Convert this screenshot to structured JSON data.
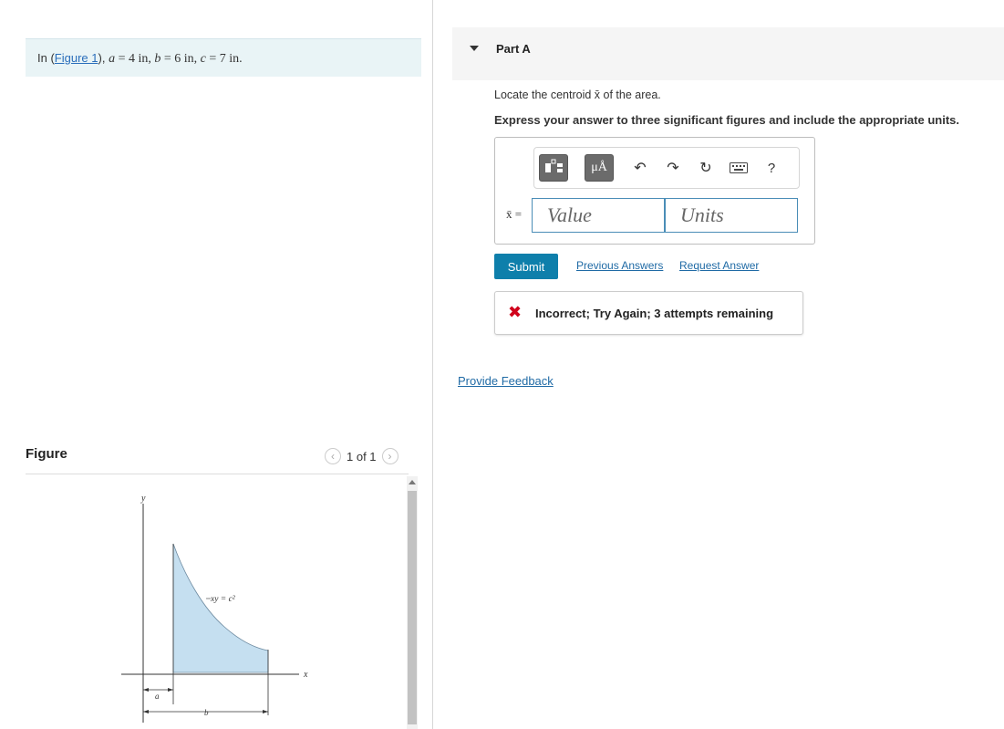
{
  "problem": {
    "prefix": "In (",
    "figure_link": "Figure 1",
    "suffix": "),",
    "a_var": "a",
    "a_val": " = 4 in, ",
    "b_var": "b",
    "b_val": " = 6 in, ",
    "c_var": "c",
    "c_val": " = 7 in."
  },
  "figure_panel": {
    "title": "Figure",
    "pager_text": "1 of 1",
    "prev_icon": "chevron-left-icon",
    "next_icon": "chevron-right-icon",
    "labels": {
      "y_axis": "y",
      "x_axis": "x",
      "curve": "xy = c²",
      "dim_a": "a",
      "dim_b": "b"
    },
    "region_color": "#c5dff0"
  },
  "part": {
    "title": "Part A",
    "question": "Locate the centroid x̄ of the area.",
    "instruction": "Express your answer to three significant figures and include the appropriate units."
  },
  "answer": {
    "label": "x̄ =",
    "value_placeholder": "Value",
    "units_placeholder": "Units",
    "toolbar": {
      "units_button": "μÅ",
      "help": "?",
      "icons": [
        "matrix-template-icon",
        "units-icon",
        "undo-icon",
        "redo-icon",
        "reset-icon",
        "keyboard-icon",
        "help-icon"
      ]
    }
  },
  "actions": {
    "submit": "Submit",
    "previous_answers": "Previous Answers",
    "request_answer": "Request Answer"
  },
  "feedback": {
    "message": "Incorrect; Try Again; 3 attempts remaining",
    "status_color": "#d0021b"
  },
  "footer": {
    "provide_feedback": "Provide Feedback"
  },
  "colors": {
    "accent": "#0e7fab",
    "link": "#1f6aa5",
    "problem_bg": "#e9f4f6"
  }
}
